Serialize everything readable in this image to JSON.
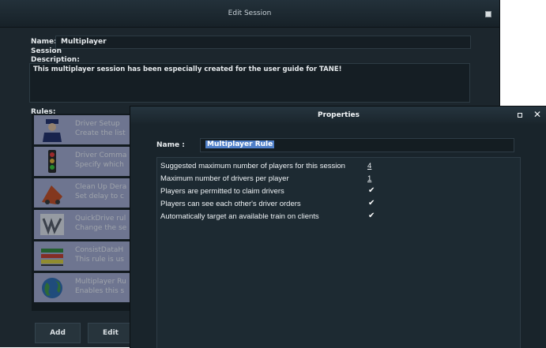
{
  "edit_session": {
    "title": "Edit Session",
    "name_label": "Name:",
    "name_value": "Multiplayer",
    "session_label": "Session",
    "description_label": "Description:",
    "description_value": "This multiplayer session has been especially created for the user guide for TANE!",
    "rules_label": "Rules:",
    "rules": [
      {
        "icon": "driver-icon",
        "title": "Driver Setup",
        "subtitle": "Create the list"
      },
      {
        "icon": "traffic-light-icon",
        "title": "Driver Comma",
        "subtitle": "Specify which"
      },
      {
        "icon": "derailment-icon",
        "title": "Clean Up Dera",
        "subtitle": "Set delay to c"
      },
      {
        "icon": "quickdrive-icon",
        "title": "QuickDrive rul",
        "subtitle": "Change the se"
      },
      {
        "icon": "consist-icon",
        "title": "ConsistDataH",
        "subtitle": "This rule is us"
      },
      {
        "icon": "globe-icon",
        "title": "Multiplayer Ru",
        "subtitle": "Enables this s"
      }
    ],
    "buttons": {
      "add": "Add",
      "edit": "Edit"
    }
  },
  "properties": {
    "title": "Properties",
    "name_label": "Name :",
    "name_value": "Multiplayer Rule",
    "rows": [
      {
        "label": "Suggested maximum number of players for this session",
        "value": "4",
        "kind": "value"
      },
      {
        "label": "Maximum number of drivers per player",
        "value": "1",
        "kind": "value"
      },
      {
        "label": "Players are permitted to claim drivers",
        "value": "✔",
        "kind": "check"
      },
      {
        "label": "Players can see each other's driver orders",
        "value": "✔",
        "kind": "check"
      },
      {
        "label": "Automatically target an available train on clients",
        "value": "✔",
        "kind": "check"
      }
    ]
  },
  "colors": {
    "window_bg": "#1c262d",
    "rule_item_bg": "#a7aed6",
    "selection": "#4f7fc8"
  }
}
